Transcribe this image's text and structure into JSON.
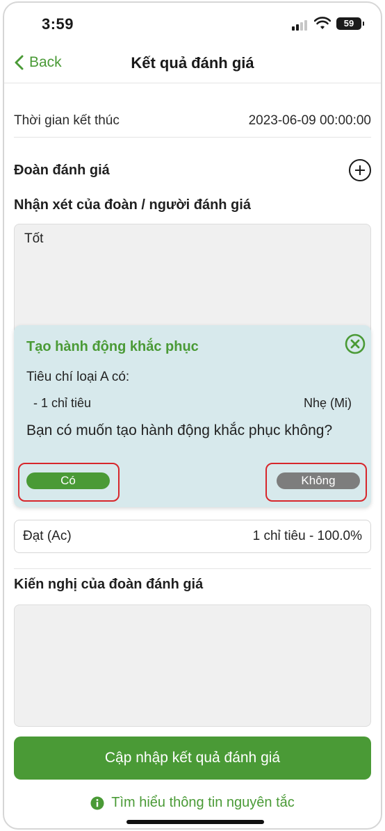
{
  "status": {
    "time": "3:59",
    "battery": "59"
  },
  "nav": {
    "back_label": "Back",
    "title": "Kết quả đánh giá"
  },
  "end_time": {
    "label": "Thời gian kết thúc",
    "value": "2023-06-09 00:00:00"
  },
  "team": {
    "label": "Đoàn đánh giá"
  },
  "comment": {
    "label": "Nhận xét của đoàn / người đánh giá",
    "value": "Tốt"
  },
  "popup": {
    "title": "Tạo hành động khắc phục",
    "line1": "Tiêu chí loại A có:",
    "item_left": "- 1 chỉ tiêu",
    "item_right": "Nhẹ (Mi)",
    "question": "Bạn có muốn tạo hành động khắc phục không?",
    "yes_label": "Có",
    "no_label": "Không"
  },
  "pass": {
    "label": "Đạt (Ac)",
    "value": "1 chỉ tiêu - 100.0%"
  },
  "recommendation": {
    "label": "Kiến nghị của đoàn đánh giá",
    "value": ""
  },
  "update_button": "Cập nhập kết quả đánh giá",
  "learn_link": "Tìm hiểu thông tin nguyên tắc",
  "colors": {
    "accent": "#4a9a36",
    "popup_bg": "#d7e9ec",
    "highlight": "#d7262b",
    "no_button": "#7d7d7d"
  }
}
